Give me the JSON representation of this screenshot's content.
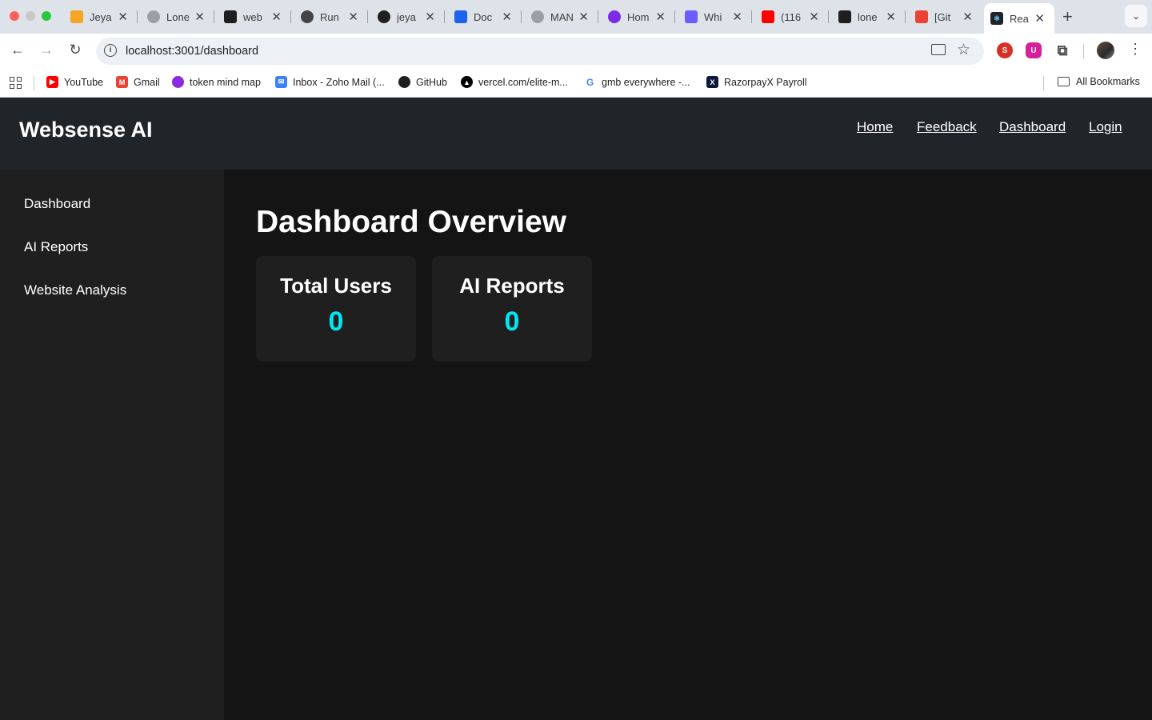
{
  "browser": {
    "tabs": [
      {
        "title": "Jeya",
        "icon": "jeya-favicon-icon",
        "color": "#f5a623"
      },
      {
        "title": "Lone",
        "icon": "globe-icon",
        "color": "#9aa0a6"
      },
      {
        "title": "web",
        "icon": "web-favicon-icon",
        "color": "#1f1f1f"
      },
      {
        "title": "Run",
        "icon": "openai-icon",
        "color": "#444444"
      },
      {
        "title": "jeya",
        "icon": "github-icon",
        "color": "#1f1f1f"
      },
      {
        "title": "Doc",
        "icon": "docker-icon",
        "color": "#1d63ed"
      },
      {
        "title": "MAN",
        "icon": "globe-icon",
        "color": "#9aa0a6"
      },
      {
        "title": "Hom",
        "icon": "canva-icon",
        "color": "#7d2ae8"
      },
      {
        "title": "Whi",
        "icon": "heart-favicon-icon",
        "color": "#6b5cff"
      },
      {
        "title": "(116",
        "icon": "youtube-icon",
        "color": "#ff0000"
      },
      {
        "title": "lone",
        "icon": "lone-favicon-icon",
        "color": "#1f1f1f"
      },
      {
        "title": "[Git",
        "icon": "gmail-icon",
        "color": "#ea4335"
      },
      {
        "title": "Rea",
        "icon": "react-icon",
        "color": "#20232a"
      }
    ],
    "url": "localhost:3001/dashboard",
    "bookmarks": [
      {
        "label": "YouTube",
        "icon": "youtube-icon",
        "color": "#ff0000"
      },
      {
        "label": "Gmail",
        "icon": "gmail-icon",
        "color": "#ea4335"
      },
      {
        "label": "token mind map",
        "icon": "mindmap-icon",
        "color": "#8a2be2"
      },
      {
        "label": "Inbox - Zoho Mail (...",
        "icon": "zoho-mail-icon",
        "color": "#3b82f6"
      },
      {
        "label": "GitHub",
        "icon": "github-icon",
        "color": "#1f1f1f"
      },
      {
        "label": "vercel.com/elite-m...",
        "icon": "vercel-icon",
        "color": "#000000"
      },
      {
        "label": "gmb everywhere -...",
        "icon": "google-icon",
        "color": "#4285f4"
      },
      {
        "label": "RazorpayX Payroll",
        "icon": "razorpay-icon",
        "color": "#0b1a3a"
      }
    ],
    "all_bookmarks": "All Bookmarks"
  },
  "header": {
    "brand": "Websense AI",
    "nav": [
      "Home",
      "Feedback",
      "Dashboard",
      "Login"
    ]
  },
  "sidebar": {
    "items": [
      {
        "label": "Dashboard"
      },
      {
        "label": "AI Reports"
      },
      {
        "label": "Website Analysis"
      }
    ]
  },
  "main": {
    "title": "Dashboard Overview",
    "cards": [
      {
        "label": "Total Users",
        "value": "0"
      },
      {
        "label": "AI Reports",
        "value": "0"
      }
    ],
    "accent_color": "#00e8f0"
  }
}
